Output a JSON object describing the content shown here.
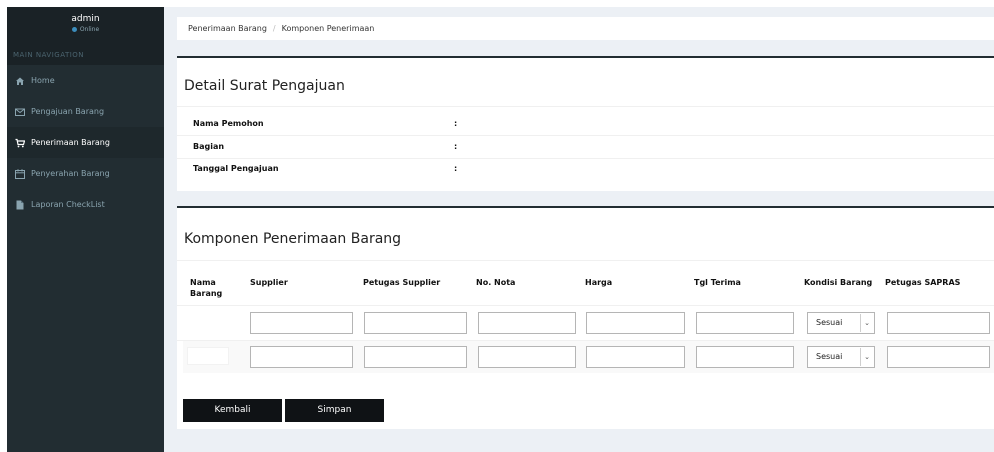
{
  "user": {
    "name": "admin",
    "status": "Online"
  },
  "nav": {
    "header": "MAIN NAVIGATION",
    "items": [
      {
        "label": "Home",
        "icon": "home-icon"
      },
      {
        "label": "Pengajuan Barang",
        "icon": "envelope-icon"
      },
      {
        "label": "Penerimaan Barang",
        "icon": "cart-icon"
      },
      {
        "label": "Penyerahan Barang",
        "icon": "calendar-icon"
      },
      {
        "label": "Laporan CheckList",
        "icon": "file-icon"
      }
    ]
  },
  "breadcrumb": {
    "parent": "Penerimaan Barang",
    "separator": "/",
    "current": "Komponen Penerimaan"
  },
  "detail": {
    "title": "Detail Surat Pengajuan",
    "fields": [
      {
        "label": "Nama Pemohon",
        "colon": ":"
      },
      {
        "label": "Bagian",
        "colon": ":"
      },
      {
        "label": "Tanggal Pengajuan",
        "colon": ":"
      }
    ]
  },
  "komponen": {
    "title": "Komponen Penerimaan Barang",
    "columns": [
      "Nama Barang",
      "Supplier",
      "Petugas Supplier",
      "No. Nota",
      "Harga",
      "Tgl Terima",
      "Kondisi Barang",
      "Petugas SAPRAS"
    ],
    "rows": [
      {
        "kondisi": "Sesuai"
      },
      {
        "kondisi": "Sesuai"
      }
    ],
    "kembali_label": "Kembali",
    "simpan_label": "Simpan"
  },
  "colors": {
    "sidebar": "#222d32",
    "content_bg": "#ecf0f5",
    "button": "#0f1215"
  }
}
